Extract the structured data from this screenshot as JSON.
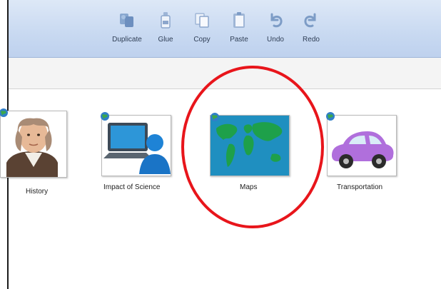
{
  "toolbar": {
    "buttons": [
      {
        "label": "Duplicate",
        "icon": "duplicate-icon"
      },
      {
        "label": "Glue",
        "icon": "glue-icon"
      },
      {
        "label": "Copy",
        "icon": "copy-icon"
      },
      {
        "label": "Paste",
        "icon": "paste-icon"
      },
      {
        "label": "Undo",
        "icon": "undo-icon"
      },
      {
        "label": "Redo",
        "icon": "redo-icon"
      }
    ]
  },
  "items": [
    {
      "label": "History",
      "icon": "portrait-icon"
    },
    {
      "label": "Impact of Science",
      "icon": "computer-user-icon"
    },
    {
      "label": "Maps",
      "icon": "world-map-icon"
    },
    {
      "label": "Transportation",
      "icon": "car-icon"
    }
  ],
  "colors": {
    "toolbar_bg": "#c8d9f1",
    "icon_blue": "#7d9cc6",
    "highlight_circle": "#e8151b",
    "map_ocean": "#1f8fc0",
    "map_land": "#1ea04a",
    "car_body": "#b06fdc"
  }
}
